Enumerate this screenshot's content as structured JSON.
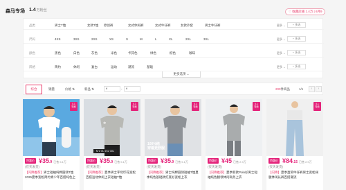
{
  "store": {
    "name": "森马专场",
    "fans": "1.4",
    "fans_unit": "万粉丝",
    "fav_button": "♡ 收藏店铺 1.4万 | 6月9"
  },
  "filters": [
    {
      "label": "品类",
      "options": [
        "男士T恤",
        "女款T恤",
        "原创裤",
        "女式休闲裤",
        "女式牛仔裤",
        "女款外套",
        "男士牛仔裤"
      ],
      "more": "更多 ⌄",
      "multi": "+ 多选"
    },
    {
      "label": "尺码",
      "options": [
        "4XS",
        "3XS",
        "2XS",
        "XS",
        "S",
        "M",
        "L",
        "XL",
        "2XL",
        "3XL"
      ],
      "more": "更多 ⌄",
      "multi": "+ 多选"
    },
    {
      "label": "颜色",
      "options": [
        "黑色",
        "白色",
        "灰色",
        "米色",
        "卡其色",
        "绿色",
        "棕色",
        "咖啡"
      ],
      "more": "更多 ⌄",
      "multi": "+ 多选"
    },
    {
      "label": "风格",
      "options": [
        "简约",
        "休闲",
        "复古",
        "运动",
        "潮流",
        "基础"
      ],
      "more": "更多 ⌄",
      "multi": "+ 多选"
    }
  ],
  "more_options": "更多选项 ⌄",
  "sortbar": {
    "default": "综合",
    "sales": "销量",
    "price": "价格 ⇅",
    "newest": "新品 ⇅",
    "price_min_placeholder": "¥",
    "price_max_placeholder": "¥",
    "result_count": "200",
    "result_unit": "件商品",
    "page": "1/1",
    "prev": "‹",
    "next": "›"
  },
  "products": [
    {
      "badge_line1": "5.1",
      "badge_line2": "特卖",
      "fresh": "特惠价",
      "price_int": "¥35",
      "price_dec": ".9",
      "sold": "已售 5.1万",
      "deadline": "(仅天发货)",
      "title_tag": "【闪降推荐】",
      "title": "男士短袖纯棉圆领T恤2025夏季宽松简约青少年百搭纯色上衣",
      "colors": {
        "bg": "#5aa9e0",
        "shirt": "#ffffff",
        "skin": "#e8c4a0",
        "pant": "#2c3e50"
      }
    },
    {
      "badge_line1": "5.1",
      "badge_line2": "特卖",
      "fresh": "特惠价",
      "price_int": "¥35",
      "price_dec": ".9",
      "sold": "已售 5.1万",
      "deadline": "(仅天发货)",
      "title_tag": "【闪降推荐】",
      "title": "夏季男士字母印花宽松百搭运动休闲上衣短袖T恤",
      "colors": {
        "bg": "#d8dde2",
        "shirt": "#b8b9b5",
        "skin": "#e8c4a0",
        "pant": "#1e1e1e"
      }
    },
    {
      "badge_line1": "5.1",
      "badge_line2": "特卖",
      "fresh": "特惠价",
      "price_int": "¥35",
      "price_dec": ".9",
      "sold": "已售 5.1万",
      "deadline": "(仅天发货)",
      "title_tag": "【闪降推荐】",
      "title": "男士纯棉圆领短袖T恤夏季纯色基础款打底衫宽松上衣",
      "colors": {
        "bg": "#e0e2e5",
        "shirt": "#8e9297",
        "skin": "#e8c4a0",
        "pant": "#6a8fb5"
      }
    },
    {
      "badge_line1": "5.1",
      "badge_line2": "特卖",
      "fresh": "特惠价",
      "price_int": "¥45",
      "price_dec": "",
      "sold": "已售 2.9万",
      "deadline": "(仅天发货)",
      "title_tag": "【闪降推荐】",
      "title": "夏季新款Polo衫男士短袖纯色翻领休闲商务上衣",
      "colors": {
        "bg": "#eef0f2",
        "shirt": "#a9acad",
        "skin": "#e8c4a0",
        "pant": "#7a7e83"
      }
    },
    {
      "badge_line1": "5.1",
      "badge_line2": "特卖",
      "fresh": "特惠价",
      "price_int": "¥84",
      "price_dec": ".15",
      "sold": "已售 2.9万",
      "deadline": "(仅天发货)",
      "title_tag": "【闪降】",
      "title": "夏季直筒牛仔裤男士宽松阔腿休闲长裤百搭潮流",
      "colors": {
        "bg": "#f0f0f0",
        "shirt": "#e8e8e8",
        "skin": "#e8c4a0",
        "pant": "#a9c4dc"
      }
    }
  ]
}
